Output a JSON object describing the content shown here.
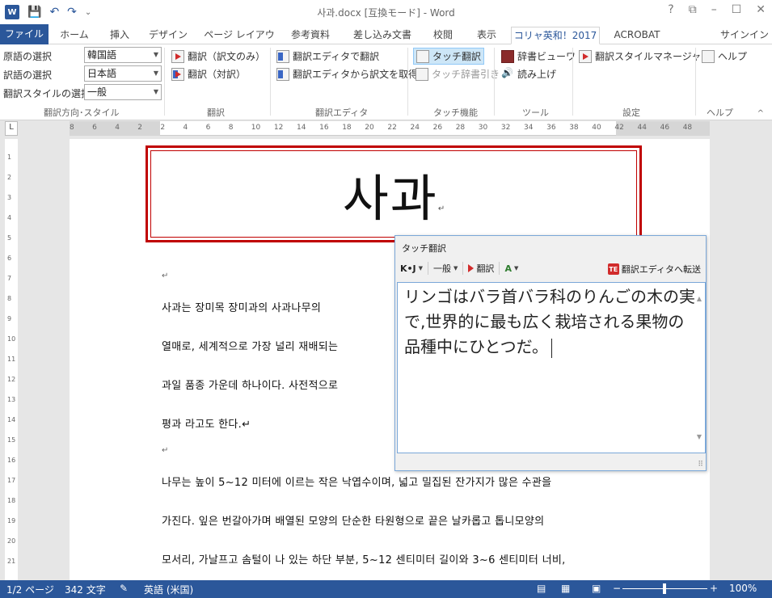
{
  "window": {
    "title": "사과.docx [互換モード] - Word",
    "help": "?",
    "minimize": "–",
    "maximize": "☐",
    "close": "✕"
  },
  "qat": {
    "logo": "W",
    "save": "💾",
    "undo": "↶",
    "redo": "↷",
    "customize": "⌄"
  },
  "tabs": [
    {
      "label": "ファイル"
    },
    {
      "label": "ホーム"
    },
    {
      "label": "挿入"
    },
    {
      "label": "デザイン"
    },
    {
      "label": "ページ レイアウト"
    },
    {
      "label": "参考資料"
    },
    {
      "label": "差し込み文書"
    },
    {
      "label": "校閲"
    },
    {
      "label": "表示"
    },
    {
      "label": "コリャ英和！2017"
    },
    {
      "label": "ACROBAT"
    }
  ],
  "signin": "サインイン",
  "ribbon": {
    "direction": {
      "source_label": "原語の選択",
      "source_value": "韓国語",
      "target_label": "訳語の選択",
      "target_value": "日本語",
      "style_label": "翻訳スタイルの選択",
      "style_value": "一般",
      "group_label": "翻訳方向･スタイル"
    },
    "translate": {
      "only": "翻訳（訳文のみ）",
      "parallel": "翻訳（対訳）",
      "group_label": "翻訳"
    },
    "editor": {
      "translate_in_editor": "翻訳エディタで翻訳",
      "get_from_editor": "翻訳エディタから訳文を取得",
      "group_label": "翻訳エディタ"
    },
    "touch": {
      "touch_translate": "タッチ翻訳",
      "touch_dictionary": "タッチ辞書引き",
      "group_label": "タッチ機能"
    },
    "tools": {
      "dictionary_viewer": "辞書ビューワ",
      "read_aloud": "読み上げ",
      "group_label": "ツール"
    },
    "settings": {
      "style_manager": "翻訳スタイルマネージャ",
      "group_label": "設定"
    },
    "help": {
      "help": "ヘルプ",
      "group_label": "ヘルプ"
    },
    "collapse": "^"
  },
  "ruler": {
    "corner": "L",
    "h_ticks": [
      "8",
      "6",
      "4",
      "2",
      "2",
      "4",
      "6",
      "8",
      "10",
      "12",
      "14",
      "16",
      "18",
      "20",
      "22",
      "24",
      "26",
      "28",
      "30",
      "32",
      "34",
      "36",
      "38",
      "40",
      "42",
      "44",
      "46",
      "48"
    ],
    "v_ticks": [
      "1",
      "2",
      "3",
      "4",
      "5",
      "6",
      "7",
      "8",
      "9",
      "10",
      "11",
      "12",
      "13",
      "14",
      "15",
      "16",
      "17",
      "18",
      "19",
      "20",
      "21"
    ]
  },
  "document": {
    "title": "사과",
    "mark": "↵",
    "lines": [
      "사과는 장미목 장미과의 사과나무의",
      "열매로, 세계적으로 가장 널리 재배되는",
      "과일 품종 가운데 하나이다. 사전적으로",
      "평과 라고도 한다.↵",
      "나무는 높이 5~12 미터에 이르는 작은 낙엽수이며, 넓고 밀집된 잔가지가 많은 수관을",
      "가진다. 잎은 번갈아가며 배열된 모양의 단순한 타원형으로 끝은 날카롭고 톱니모양의",
      "모서리, 가날프고 솜털이 나 있는 하단 부분, 5~12 센티미터 길이와 3~6 센티미터 너비,"
    ]
  },
  "popup": {
    "title": "タッチ翻訳",
    "direction": "K•J",
    "style": "一般",
    "translate": "翻訳",
    "transfer": "翻訳エディタへ転送",
    "transfer_badge": "TE",
    "text": "リンゴはバラ首バラ科のりんごの木の実で,世界的に最も広く栽培される果物の品種中にひとつだ。",
    "scroll_up": "▲",
    "scroll_down": "▼",
    "grip": "⠿"
  },
  "status": {
    "pages": "1/2 ページ",
    "words": "342 文字",
    "language": "英語 (米国)",
    "zoom_minus": "−",
    "zoom_plus": "+",
    "zoom": "100%"
  }
}
